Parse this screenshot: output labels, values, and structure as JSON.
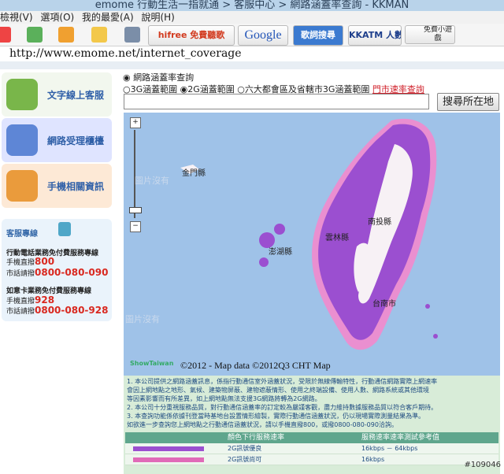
{
  "window": {
    "title": "emome 行動生活一指就通 > 客服中心 > 網路涵蓋率查詢 - KKMAN"
  },
  "menu": [
    "檢視(V)",
    "選項(O)",
    "我的最愛(A)",
    "說明(H)"
  ],
  "toolbar": {
    "buttons": [
      "hifree 免費聽歌",
      "Google",
      "歌詞搜尋",
      "KKATM 人數",
      "免費小遊戲"
    ]
  },
  "address": {
    "url": "http://www.emome.net/internet_coverage"
  },
  "sidebar": {
    "items": [
      "文字線上客服",
      "網路受理櫃檯",
      "手機相關資訊"
    ],
    "hotline": {
      "title": "客服專線",
      "section1_title": "行動電話業務免付費服務專線",
      "mobile_label": "手機直撥",
      "mobile_number1": "800",
      "city_label": "市話請撥",
      "city_number1": "0800-080-090",
      "section2_title": "如意卡業務免付費服務專線",
      "mobile_number2": "928",
      "city_number2": "0800-080-928"
    }
  },
  "main": {
    "section_title": "網路涵蓋率查詢",
    "radio_options": [
      "3G涵蓋範圍",
      "2G涵蓋範圍",
      "六大都會區及省轄市3G涵蓋範圍"
    ],
    "selected_radio": "2G涵蓋範圍",
    "link_text": "門市速率查詢",
    "search_button": "搜尋所在地",
    "map": {
      "labels": [
        "金門縣",
        "南投縣",
        "雲林縣",
        "台南市",
        "澎湖縣"
      ],
      "faded_text_1": "圖片沒有",
      "faded_text_2": "圖片沒有",
      "logo": "ShowTaiwan",
      "attribution": "©2012 - Map data ©2012Q3 CHT Map"
    },
    "notes": [
      "1. 本公司提供之網路涵蓋訊息，係指行動通信室外涵蓋狀況，受限於無線傳輸特性，行動通信網路實際上網速率",
      "會因上網地點之地形、氣候、建築物屏蔽、建物遮蔽情形、使用之終端設備、使用人數、網路系統或其他環境",
      "等因素影響而有所差異，如上網地點無法支援3G網路將轉為2G網路。",
      "2. 本公司十分重視服務品質，對行動通信涵蓋率的訂定較為嚴謹客觀，盡力維持數據服務品質以符合客戶期待。",
      "3. 本查詢功能係依據刊登當時基地台設置情形繪製，實際行動通信涵蓋狀況，仍以現場實際測量結果為準。",
      "如欲進一步查詢您上網地點之行動通信涵蓋狀況，請以手機直撥800，或撥0800-080-090洽詢。"
    ],
    "table": {
      "header": [
        "顏色下行服務速率",
        "服務速率速率測試參考值"
      ],
      "rows": [
        {
          "color": "#9b4fd0",
          "label": "2G訊號優良",
          "value": "16kbps － 64kbps"
        },
        {
          "color": "#e06ab8",
          "label": "2G訊號尚可",
          "value": "16kbps"
        }
      ]
    }
  },
  "watermark": "#109046"
}
